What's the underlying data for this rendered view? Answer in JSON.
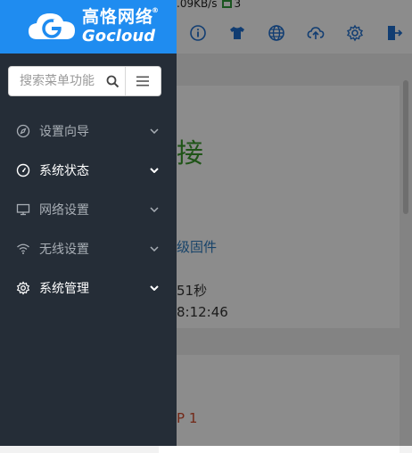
{
  "brand": {
    "name_cn": "高恪网络",
    "name_en": "Gocloud",
    "reg_mark": "®",
    "color": "#1f8cf0"
  },
  "status_bar": {
    "speed": ".09KB/s",
    "device_count": "3"
  },
  "toolbar_icons": [
    "info-icon",
    "shirt-icon",
    "globe-icon",
    "cloud-upload-icon",
    "gear-icon",
    "logout-icon"
  ],
  "search": {
    "placeholder": "搜索菜单功能"
  },
  "nav": {
    "items": [
      {
        "label": "设置向导",
        "icon": "compass-icon",
        "emphasis": false
      },
      {
        "label": "系统状态",
        "icon": "speedometer-icon",
        "emphasis": true
      },
      {
        "label": "网络设置",
        "icon": "monitor-icon",
        "emphasis": false
      },
      {
        "label": "无线设置",
        "icon": "wifi-icon",
        "emphasis": false
      },
      {
        "label": "系统管理",
        "icon": "gear-icon",
        "emphasis": true
      }
    ]
  },
  "main": {
    "connection_status_partial": "接",
    "upgrade_link_partial": "级固件",
    "uptime_partial": "51秒",
    "time_partial": "8:12:46",
    "red_label_partial": "P 1"
  },
  "colors": {
    "sidebar_bg": "#252d37",
    "status_green": "#3a9a2a",
    "link_blue": "#2a7ac0",
    "alert_red": "#d24a2a"
  }
}
